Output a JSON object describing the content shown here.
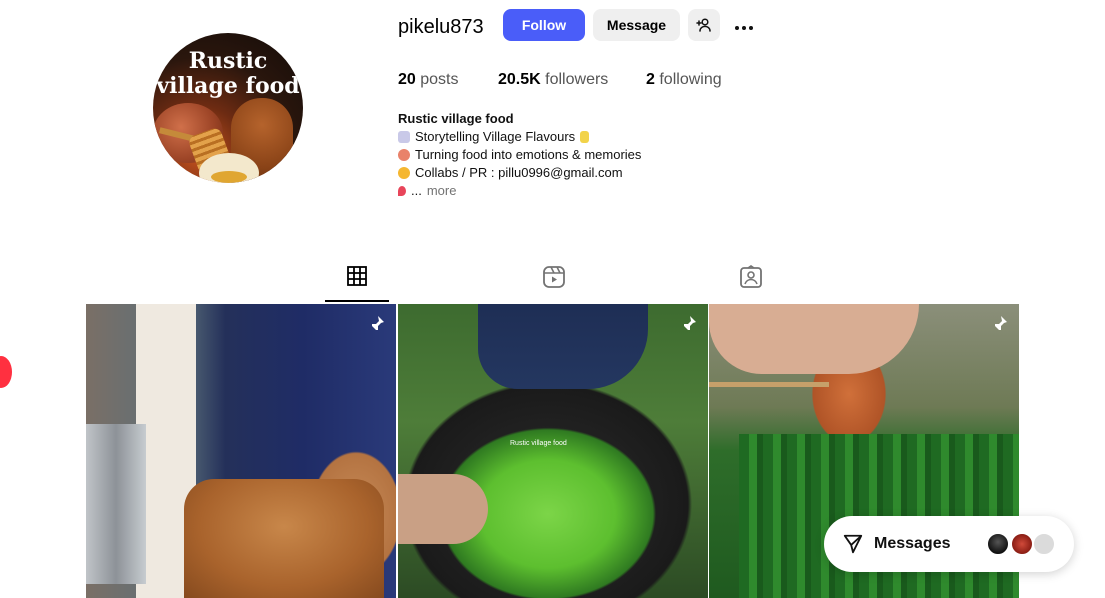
{
  "profile": {
    "username": "pikelu873",
    "avatar_text_line1": "Rustic",
    "avatar_text_line2": "village food",
    "follow_label": "Follow",
    "message_label": "Message",
    "add_user_icon": "person-plus-icon",
    "more_icon": "more-horizontal-icon"
  },
  "stats": {
    "posts_count": "20",
    "posts_label": "posts",
    "followers_count": "20.5K",
    "followers_label": "followers",
    "following_count": "2",
    "following_label": "following"
  },
  "bio": {
    "name": "Rustic village food",
    "lines": [
      "Storytelling Village Flavours",
      "Turning food into emotions & memories",
      "Collabs / PR : pillu0996@gmail.com"
    ],
    "truncation": "...",
    "more_label": "more"
  },
  "tabs": [
    {
      "name": "posts",
      "icon": "grid-icon",
      "active": true
    },
    {
      "name": "reels",
      "icon": "reels-icon",
      "active": false
    },
    {
      "name": "tagged",
      "icon": "tagged-user-icon",
      "active": false
    }
  ],
  "posts": [
    {
      "pinned": true,
      "caption": ""
    },
    {
      "pinned": true,
      "caption": "Rustic village food"
    },
    {
      "pinned": true,
      "caption": ""
    }
  ],
  "messages": {
    "label": "Messages",
    "icon": "send-icon"
  },
  "colors": {
    "follow_button": "#4a5df9",
    "secondary_button": "#efefef",
    "muted_text": "#737373",
    "notification_red": "#ff3040"
  }
}
